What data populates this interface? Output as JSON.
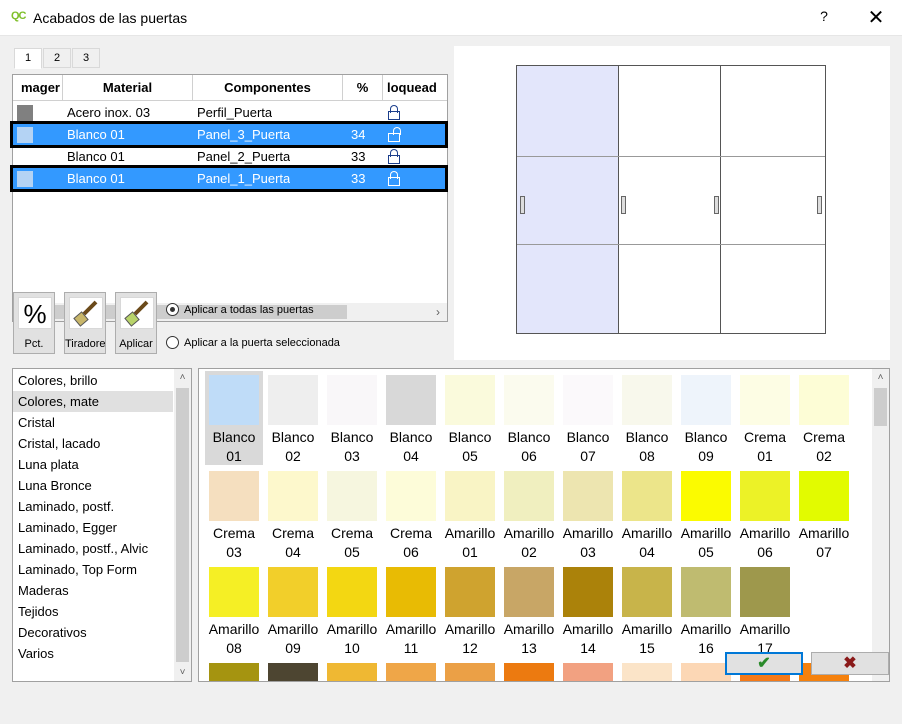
{
  "window": {
    "title": "Acabados de las puertas",
    "app_icon_text": "QC",
    "help_label": "?",
    "close_label": "✕"
  },
  "tabs": [
    "1",
    "2",
    "3"
  ],
  "table": {
    "columns": [
      "mager",
      "Material",
      "Componentes",
      "%",
      "loquead"
    ],
    "rows": [
      {
        "swatch": "#808080",
        "material": "Acero inox. 03",
        "component": "Perfil_Puerta",
        "pct": "",
        "locked": true,
        "selected": false
      },
      {
        "swatch": "#b4d3f4",
        "material": "Blanco 01",
        "component": "Panel_3_Puerta",
        "pct": "34",
        "locked": false,
        "selected": true
      },
      {
        "swatch": "#ffffff",
        "material": "Blanco 01",
        "component": "Panel_2_Puerta",
        "pct": "33",
        "locked": true,
        "selected": false
      },
      {
        "swatch": "#b4d3f4",
        "material": "Blanco 01",
        "component": "Panel_1_Puerta",
        "pct": "33",
        "locked": true,
        "selected": true
      }
    ]
  },
  "annotation": "1",
  "toolbar": {
    "pct_label": "Pct.",
    "pct_icon": "%",
    "handles_label": "Tiradores",
    "apply_label": "Aplicar"
  },
  "apply_options": {
    "all": "Aplicar a todas las puertas",
    "selected": "Aplicar a la puerta seleccionada",
    "value": "all"
  },
  "categories": {
    "items": [
      "Colores, brillo",
      "Colores, mate",
      "Cristal",
      "Cristal, lacado",
      "Luna plata",
      "Luna Bronce",
      "Laminado, postf.",
      "Laminado, Egger",
      "Laminado, postf., Alvic",
      "Laminado, Top Form",
      "Maderas",
      "Tejidos",
      "Decorativos",
      "Varios"
    ],
    "selected_index": 1
  },
  "palette": {
    "selected_index": 0,
    "rows": [
      [
        {
          "line1": "Blanco",
          "line2": "01",
          "color": "#bfdcf8"
        },
        {
          "line1": "Blanco",
          "line2": "02",
          "color": "#eeeeee"
        },
        {
          "line1": "Blanco",
          "line2": "03",
          "color": "#f9f7f9"
        },
        {
          "line1": "Blanco",
          "line2": "04",
          "color": "#d8d8d8"
        },
        {
          "line1": "Blanco",
          "line2": "05",
          "color": "#fafadc"
        },
        {
          "line1": "Blanco",
          "line2": "06",
          "color": "#fbfbee"
        },
        {
          "line1": "Blanco",
          "line2": "07",
          "color": "#fbf9fb"
        },
        {
          "line1": "Blanco",
          "line2": "08",
          "color": "#f8f8ec"
        },
        {
          "line1": "Blanco",
          "line2": "09",
          "color": "#eef4fb"
        },
        {
          "line1": "Crema",
          "line2": "01",
          "color": "#fdfde4"
        },
        {
          "line1": "Crema",
          "line2": "02",
          "color": "#fdfdd6"
        }
      ],
      [
        {
          "line1": "Crema",
          "line2": "03",
          "color": "#f5dfbf"
        },
        {
          "line1": "Crema",
          "line2": "04",
          "color": "#fdf8cc"
        },
        {
          "line1": "Crema",
          "line2": "05",
          "color": "#f6f6df"
        },
        {
          "line1": "Crema",
          "line2": "06",
          "color": "#fdfcd9"
        },
        {
          "line1": "Amarillo",
          "line2": "01",
          "color": "#f9f4c5"
        },
        {
          "line1": "Amarillo",
          "line2": "02",
          "color": "#f0efbf"
        },
        {
          "line1": "Amarillo",
          "line2": "03",
          "color": "#ede5b0"
        },
        {
          "line1": "Amarillo",
          "line2": "04",
          "color": "#ece58a"
        },
        {
          "line1": "Amarillo",
          "line2": "05",
          "color": "#fbfb00"
        },
        {
          "line1": "Amarillo",
          "line2": "06",
          "color": "#ecf227"
        },
        {
          "line1": "Amarillo",
          "line2": "07",
          "color": "#e2fb00"
        }
      ],
      [
        {
          "line1": "Amarillo",
          "line2": "08",
          "color": "#f5ef25"
        },
        {
          "line1": "Amarillo",
          "line2": "09",
          "color": "#f2cf2a"
        },
        {
          "line1": "Amarillo",
          "line2": "10",
          "color": "#f3d712"
        },
        {
          "line1": "Amarillo",
          "line2": "11",
          "color": "#e8bb04"
        },
        {
          "line1": "Amarillo",
          "line2": "12",
          "color": "#cfa32f"
        },
        {
          "line1": "Amarillo",
          "line2": "13",
          "color": "#c8a666"
        },
        {
          "line1": "Amarillo",
          "line2": "14",
          "color": "#ab820a"
        },
        {
          "line1": "Amarillo",
          "line2": "15",
          "color": "#c8b44a"
        },
        {
          "line1": "Amarillo",
          "line2": "16",
          "color": "#bfbb70"
        },
        {
          "line1": "Amarillo",
          "line2": "17",
          "color": "#9e984c"
        }
      ],
      [
        {
          "line1": "",
          "line2": "",
          "color": "#a59410"
        },
        {
          "line1": "",
          "line2": "",
          "color": "#4d4531"
        },
        {
          "line1": "",
          "line2": "",
          "color": "#efb833"
        },
        {
          "line1": "",
          "line2": "",
          "color": "#efa648"
        },
        {
          "line1": "",
          "line2": "",
          "color": "#eba046"
        },
        {
          "line1": "",
          "line2": "",
          "color": "#ec7a10"
        },
        {
          "line1": "",
          "line2": "",
          "color": "#f2a181"
        },
        {
          "line1": "",
          "line2": "",
          "color": "#fbe4c8"
        },
        {
          "line1": "",
          "line2": "",
          "color": "#fcd7b5"
        },
        {
          "line1": "",
          "line2": "",
          "color": "#f57a18"
        },
        {
          "line1": "",
          "line2": "",
          "color": "#f5810d"
        }
      ]
    ]
  },
  "buttons": {
    "ok": "✔",
    "cancel": "✖"
  }
}
